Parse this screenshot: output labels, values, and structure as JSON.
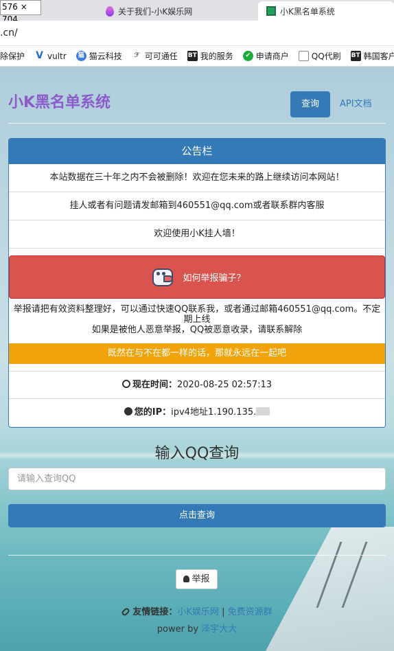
{
  "window": {
    "size_label": "576 × 704"
  },
  "tabs": [
    {
      "label": "关于我们-小K娱乐网",
      "icon": "flame-icon"
    },
    {
      "label": "小K黑名单系统",
      "icon": "site-icon",
      "active": true
    }
  ],
  "url": {
    "text": ".cn/"
  },
  "bookmarks": [
    {
      "label": "除保护",
      "icon": "none"
    },
    {
      "label": "vultr",
      "icon": "vultr-icon",
      "glyph": "V"
    },
    {
      "label": "猫云科技",
      "icon": "cat-icon",
      "glyph": "猫"
    },
    {
      "label": "可可通任",
      "icon": "fox-icon",
      "glyph": "ℱ"
    },
    {
      "label": "我的服务",
      "icon": "bt-icon",
      "glyph": "BT"
    },
    {
      "label": "申请商户",
      "icon": "shield-icon",
      "glyph": "✔"
    },
    {
      "label": "QQ代刷",
      "icon": "doc-icon",
      "glyph": ""
    },
    {
      "label": "韩国客户",
      "icon": "bt-icon",
      "glyph": "BT"
    }
  ],
  "header": {
    "site_title": "小K黑名单系统",
    "nav_query": "查询",
    "nav_api": "API文档"
  },
  "panel": {
    "title": "公告栏",
    "notices": [
      "本站数据在三十年之内不会被删除！欢迎在您未来的路上继续访问本网站！",
      "挂人或者有问题请发邮箱到460551@qq.com或者联系群内客服",
      "欢迎使用小K挂人墙！"
    ],
    "report_button": "如何举报骗子？",
    "report_line1": "举报请把有效资料整理好，可以通过快速QQ联系我，或者通过邮箱460551@qq.com。不定期上线",
    "report_line2": "如果是被他人恶意举报，QQ被恶意收录，请联系解除",
    "orange_text": "既然在与不在都一样的话，那就永远在一起吧",
    "time_label": "现在时间：",
    "time_value": "2020-08-25 02:57:13",
    "ip_label": "您的IP：",
    "ip_value": "ipv4地址1.190.135."
  },
  "query": {
    "title": "输入QQ查询",
    "placeholder": "请输入查询QQ",
    "button": "点击查询"
  },
  "footer": {
    "report": "举报",
    "links_label": "友情链接：",
    "link1": "小K娱乐网",
    "separator": "|",
    "link2": "免费资源群",
    "power_prefix": "power by",
    "power_author": "泽宇大大"
  },
  "colors": {
    "primary": "#337ab7",
    "danger": "#d9534f",
    "warning": "#f0a30a",
    "title_purple": "#8b5cc9"
  }
}
